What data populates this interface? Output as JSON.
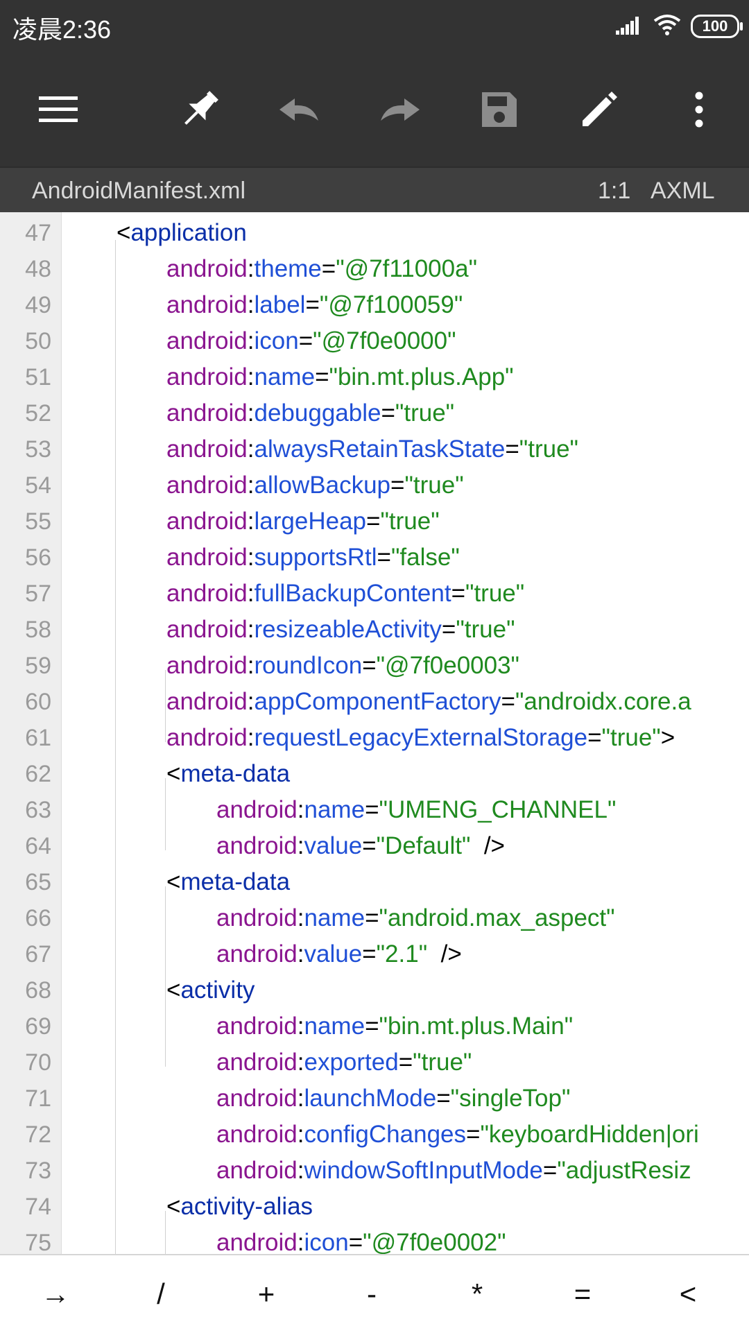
{
  "status_bar": {
    "time": "凌晨2:36",
    "battery": "100"
  },
  "toolbar": {
    "menu_icon": "menu-icon",
    "pin_icon": "pin-icon",
    "undo_icon": "undo-icon",
    "redo_icon": "redo-icon",
    "save_icon": "save-icon",
    "edit_icon": "edit-icon",
    "more_icon": "more-vert-icon"
  },
  "file_bar": {
    "filename": "AndroidManifest.xml",
    "cursor": "1:1",
    "type": "AXML"
  },
  "code_lines": [
    {
      "num": "47",
      "indent": 0,
      "tag": "application"
    },
    {
      "num": "48",
      "indent": 1,
      "ns": "android",
      "attr": "theme",
      "val": "\"@7f11000a\""
    },
    {
      "num": "49",
      "indent": 1,
      "ns": "android",
      "attr": "label",
      "val": "\"@7f100059\""
    },
    {
      "num": "50",
      "indent": 1,
      "ns": "android",
      "attr": "icon",
      "val": "\"@7f0e0000\""
    },
    {
      "num": "51",
      "indent": 1,
      "ns": "android",
      "attr": "name",
      "val": "\"bin.mt.plus.App\""
    },
    {
      "num": "52",
      "indent": 1,
      "ns": "android",
      "attr": "debuggable",
      "val": "\"true\""
    },
    {
      "num": "53",
      "indent": 1,
      "ns": "android",
      "attr": "alwaysRetainTaskState",
      "val": "\"true\""
    },
    {
      "num": "54",
      "indent": 1,
      "ns": "android",
      "attr": "allowBackup",
      "val": "\"true\""
    },
    {
      "num": "55",
      "indent": 1,
      "ns": "android",
      "attr": "largeHeap",
      "val": "\"true\""
    },
    {
      "num": "56",
      "indent": 1,
      "ns": "android",
      "attr": "supportsRtl",
      "val": "\"false\""
    },
    {
      "num": "57",
      "indent": 1,
      "ns": "android",
      "attr": "fullBackupContent",
      "val": "\"true\""
    },
    {
      "num": "58",
      "indent": 1,
      "ns": "android",
      "attr": "resizeableActivity",
      "val": "\"true\""
    },
    {
      "num": "59",
      "indent": 1,
      "ns": "android",
      "attr": "roundIcon",
      "val": "\"@7f0e0003\""
    },
    {
      "num": "60",
      "indent": 1,
      "ns": "android",
      "attr": "appComponentFactory",
      "val": "\"androidx.core.a"
    },
    {
      "num": "61",
      "indent": 1,
      "ns": "android",
      "attr": "requestLegacyExternalStorage",
      "val": "\"true\"",
      "tail": ">"
    },
    {
      "num": "62",
      "indent": 1,
      "tag": "meta-data"
    },
    {
      "num": "63",
      "indent": 2,
      "ns": "android",
      "attr": "name",
      "val": "\"UMENG_CHANNEL\""
    },
    {
      "num": "64",
      "indent": 2,
      "ns": "android",
      "attr": "value",
      "val": "\"Default\"",
      "tail": "  />"
    },
    {
      "num": "65",
      "indent": 1,
      "tag": "meta-data"
    },
    {
      "num": "66",
      "indent": 2,
      "ns": "android",
      "attr": "name",
      "val": "\"android.max_aspect\""
    },
    {
      "num": "67",
      "indent": 2,
      "ns": "android",
      "attr": "value",
      "val": "\"2.1\"",
      "tail": "  />"
    },
    {
      "num": "68",
      "indent": 1,
      "tag": "activity"
    },
    {
      "num": "69",
      "indent": 2,
      "ns": "android",
      "attr": "name",
      "val": "\"bin.mt.plus.Main\""
    },
    {
      "num": "70",
      "indent": 2,
      "ns": "android",
      "attr": "exported",
      "val": "\"true\""
    },
    {
      "num": "71",
      "indent": 2,
      "ns": "android",
      "attr": "launchMode",
      "val": "\"singleTop\""
    },
    {
      "num": "72",
      "indent": 2,
      "ns": "android",
      "attr": "configChanges",
      "val": "\"keyboardHidden|ori"
    },
    {
      "num": "73",
      "indent": 2,
      "ns": "android",
      "attr": "windowSoftInputMode",
      "val": "\"adjustResiz"
    },
    {
      "num": "74",
      "indent": 1,
      "tag": "activity-alias"
    },
    {
      "num": "75",
      "indent": 2,
      "ns": "android",
      "attr": "icon",
      "val": "\"@7f0e0002\""
    }
  ],
  "keys": [
    "→",
    "/",
    "+",
    "-",
    "*",
    "=",
    "<"
  ]
}
